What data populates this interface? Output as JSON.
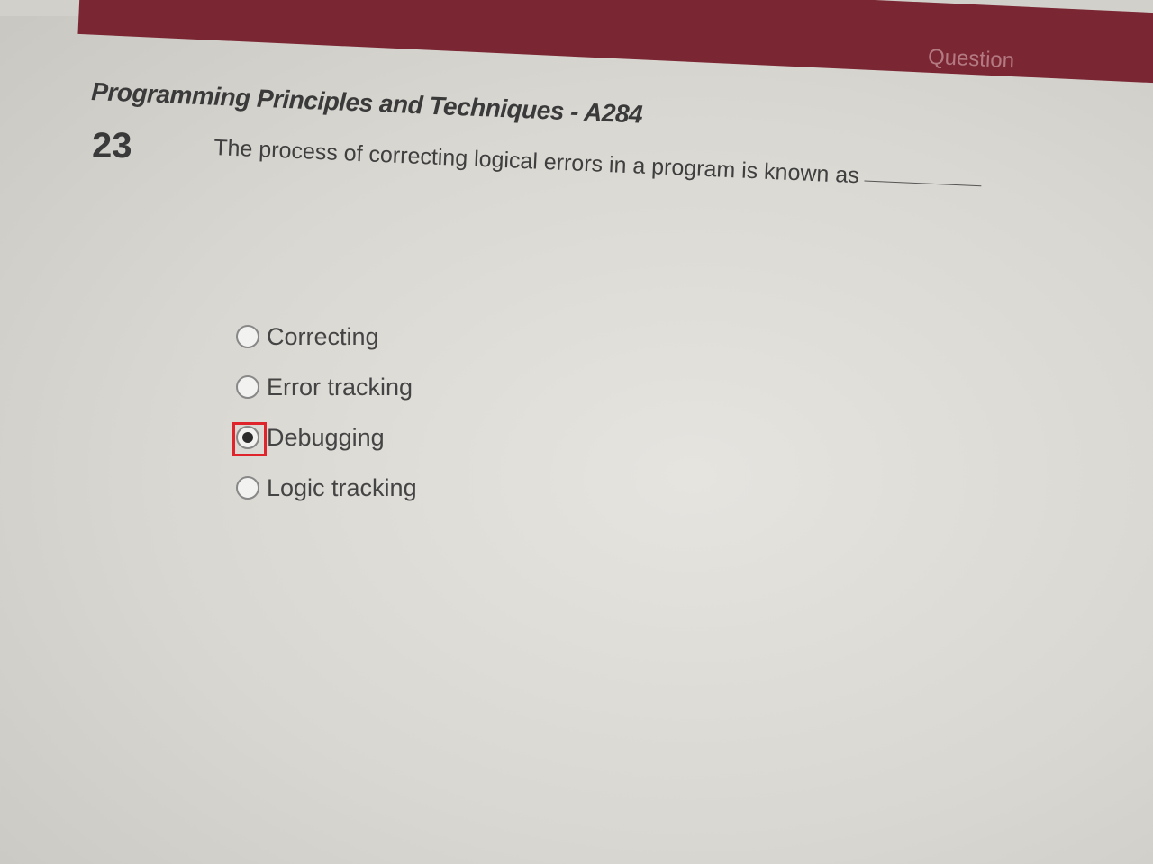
{
  "header": {
    "tab_label": "Question",
    "course_title": "Programming Principles and Techniques - A284"
  },
  "question": {
    "number": "23",
    "text": "The process of correcting logical errors in a program is known as"
  },
  "options": [
    {
      "label": "Correcting",
      "selected": false
    },
    {
      "label": "Error tracking",
      "selected": false
    },
    {
      "label": "Debugging",
      "selected": true
    },
    {
      "label": "Logic tracking",
      "selected": false
    }
  ],
  "colors": {
    "header_bar": "#7a2633",
    "highlight_box": "#e0242c"
  }
}
